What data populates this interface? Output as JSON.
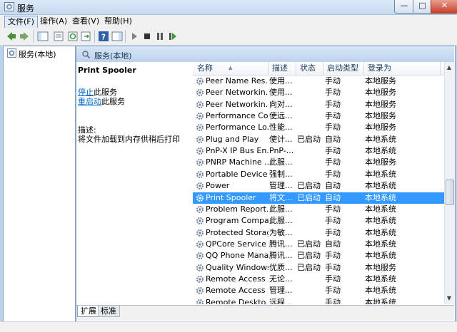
{
  "window": {
    "title": "服务",
    "controls": {
      "minimize": "—",
      "maximize": "□",
      "close": "✕"
    }
  },
  "menu": [
    "文件(F)",
    "操作(A)",
    "查看(V)",
    "帮助(H)"
  ],
  "tree": {
    "root_label": "服务(本地)"
  },
  "panel": {
    "header_title": "服务(本地)"
  },
  "detail": {
    "service_name": "Print Spooler",
    "stop_link": "停止",
    "stop_suffix": "此服务",
    "restart_link": "重启动",
    "restart_suffix": "此服务",
    "desc_label": "描述:",
    "desc_text": "将文件加载到内存供稍后打印"
  },
  "table": {
    "columns": [
      "名称",
      "描述",
      "状态",
      "启动类型",
      "登录为"
    ],
    "rows": [
      [
        "Peer Name Res...",
        "使用...",
        "",
        "手动",
        "本地服务"
      ],
      [
        "Peer Networkin...",
        "使用...",
        "",
        "手动",
        "本地服务"
      ],
      [
        "Peer Networkin...",
        "向对...",
        "",
        "手动",
        "本地服务"
      ],
      [
        "Performance Co...",
        "使远...",
        "",
        "手动",
        "本地服务"
      ],
      [
        "Performance Lo...",
        "性能...",
        "",
        "手动",
        "本地服务"
      ],
      [
        "Plug and Play",
        "使计...",
        "已启动",
        "自动",
        "本地系统"
      ],
      [
        "PnP-X IP Bus En...",
        "PnP-...",
        "",
        "手动",
        "本地系统"
      ],
      [
        "PNRP Machine ...",
        "此服...",
        "",
        "手动",
        "本地服务"
      ],
      [
        "Portable Device ...",
        "强制...",
        "",
        "手动",
        "本地系统"
      ],
      [
        "Power",
        "管理...",
        "已启动",
        "自动",
        "本地系统"
      ],
      [
        "Print Spooler",
        "将文...",
        "已启动",
        "自动",
        "本地系统"
      ],
      [
        "Problem Report...",
        "此服...",
        "",
        "手动",
        "本地系统"
      ],
      [
        "Program Compa...",
        "此服...",
        "",
        "手动",
        "本地系统"
      ],
      [
        "Protected Storage",
        "为敏...",
        "",
        "手动",
        "本地系统"
      ],
      [
        "QPCore Service",
        "腾讯...",
        "已启动",
        "自动",
        "本地系统"
      ],
      [
        "QQ Phone Mana...",
        "腾讯...",
        "已启动",
        "手动",
        "本地系统"
      ],
      [
        "Quality Windows...",
        "优质...",
        "已启动",
        "手动",
        "本地服务"
      ],
      [
        "Remote Access ...",
        "无论...",
        "",
        "手动",
        "本地系统"
      ],
      [
        "Remote Access ...",
        "管理...",
        "",
        "手动",
        "本地系统"
      ],
      [
        "Remote Deskto...",
        "远程...",
        "",
        "手动",
        "本地系统"
      ]
    ],
    "selected_row": 10
  },
  "tabs": [
    "扩展",
    "标准"
  ],
  "colors": {
    "selection": "#3399ff",
    "link": "#0066cc",
    "header": "#bcd3ec"
  }
}
